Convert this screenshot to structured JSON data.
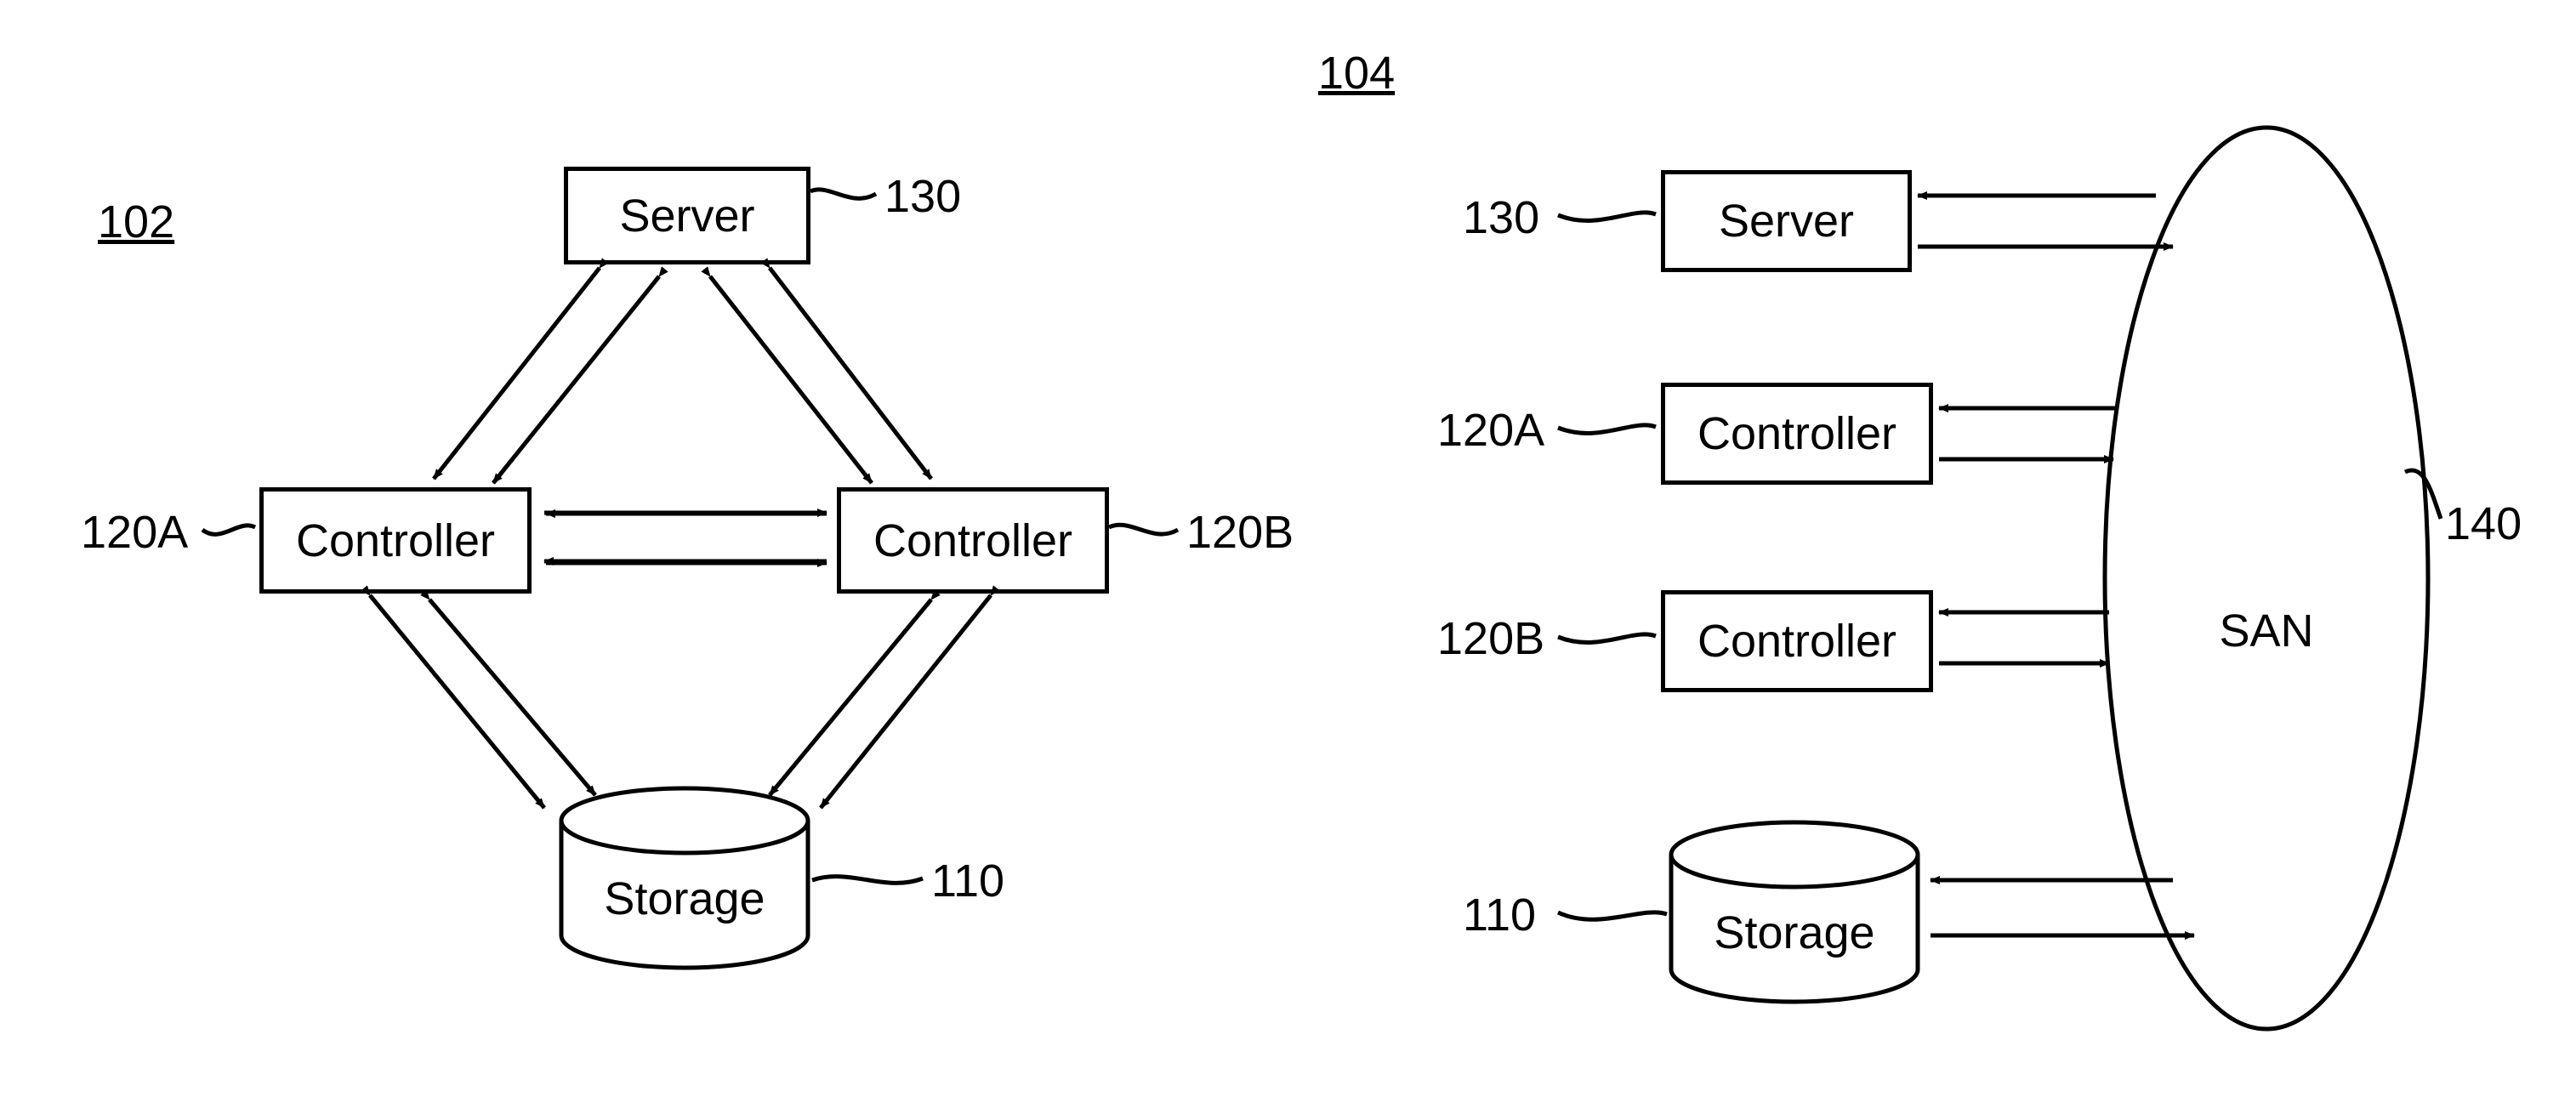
{
  "figure_refs": {
    "left_group": "102",
    "right_group": "104"
  },
  "left": {
    "server": {
      "label": "Server",
      "ref": "130"
    },
    "controllerA": {
      "label": "Controller",
      "ref": "120A"
    },
    "controllerB": {
      "label": "Controller",
      "ref": "120B"
    },
    "storage": {
      "label": "Storage",
      "ref": "110"
    }
  },
  "right": {
    "server": {
      "label": "Server",
      "ref": "130"
    },
    "controllerA": {
      "label": "Controller",
      "ref": "120A"
    },
    "controllerB": {
      "label": "Controller",
      "ref": "120B"
    },
    "storage": {
      "label": "Storage",
      "ref": "110"
    },
    "san": {
      "label": "SAN",
      "ref": "140"
    }
  }
}
